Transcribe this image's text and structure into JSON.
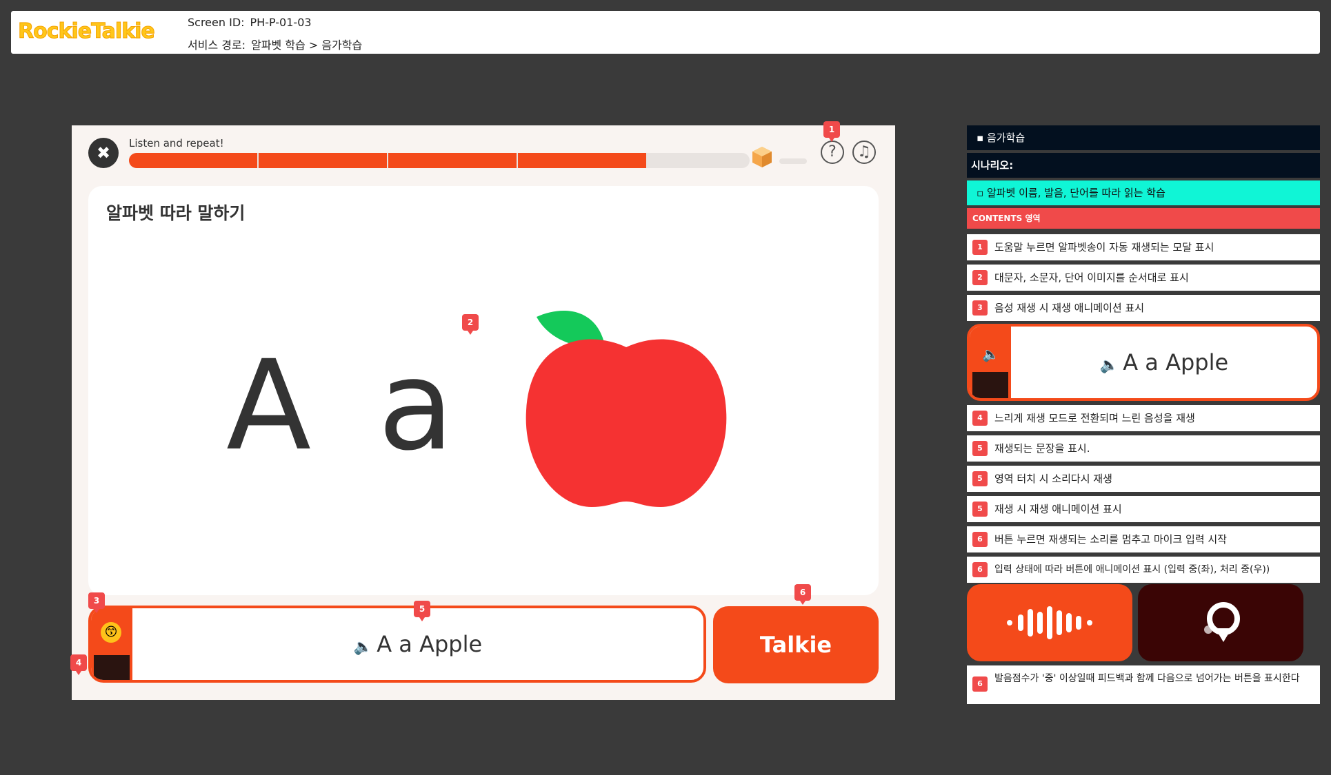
{
  "header": {
    "logo": "RockieTalkie",
    "screen_id_label": "Screen ID:",
    "screen_id": "PH-P-01-03",
    "path_label": "서비스 경로:",
    "path": "알파벳 학습 > 음가학습"
  },
  "phone": {
    "instruction": "Listen and repeat!",
    "progress_segments": 4,
    "card_title": "알파벳 따라 말하기",
    "upper": "A",
    "lower": "a",
    "sentence": "A a Apple",
    "talkie_label": "Talkie",
    "pins": {
      "p1": "1",
      "p2": "2",
      "p3": "3",
      "p4": "4",
      "p5": "5",
      "p6": "6"
    }
  },
  "panel": {
    "title": "음가학습",
    "scenario_label": "시나리오:",
    "scenario": "알파벳 이름, 발음, 단어를 따라 읽는 학습",
    "contents_label": "CONTENTS 영역",
    "items_top": [
      {
        "num": "1",
        "text": "도움말 누르면 알파벳송이 자동 재생되는 모달 표시"
      },
      {
        "num": "2",
        "text": "대문자, 소문자, 단어 이미지를 순서대로 표시"
      },
      {
        "num": "3",
        "text": "음성 재생 시 재생 애니메이션 표시"
      }
    ],
    "mini_sentence": "A a Apple",
    "items_mid": [
      {
        "num": "4",
        "text": "느리게 재생 모드로 전환되며 느린 음성을 재생"
      },
      {
        "num": "5",
        "text": "재생되는 문장을 표시."
      },
      {
        "num": "5",
        "text": "영역 터치 시 소리다시 재생"
      },
      {
        "num": "5",
        "text": "재생 시 재생 애니메이션 표시"
      },
      {
        "num": "6",
        "text": "버튼 누르면 재생되는 소리를 멈추고 마이크 입력 시작"
      },
      {
        "num": "6",
        "text": "입력 상태에 따라 버튼에 애니메이션 표시 (입력 중(좌), 처리 중(우))"
      }
    ],
    "item_last": {
      "num": "6",
      "text": "발음점수가 '중' 이상일때 피드백과 함께 다음으로 넘어가는 버튼을 표시한다"
    }
  },
  "colors": {
    "accent": "#f44a1a",
    "pin": "#f04a4a",
    "logo": "#ffc61a",
    "cyan": "#10f5d6",
    "dark": "#03101f"
  }
}
